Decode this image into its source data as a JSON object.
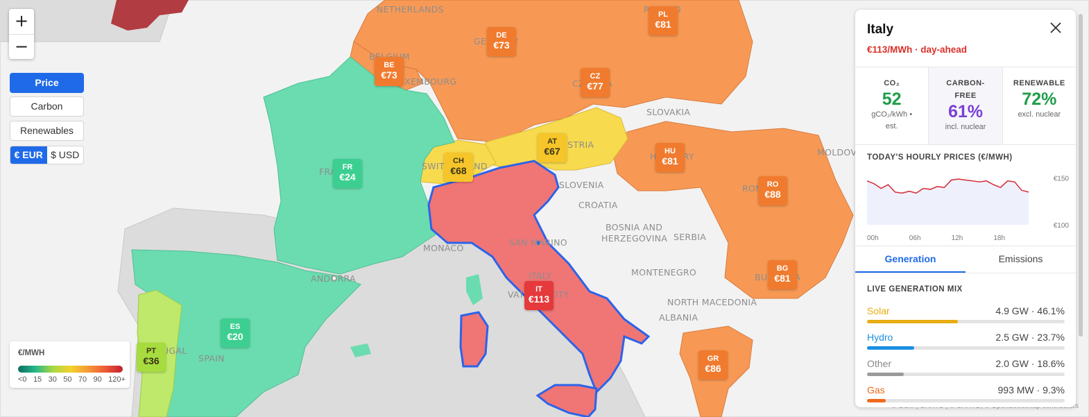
{
  "map": {
    "colors": {
      "water": "#dcdcdc",
      "land": "#f2f2f2",
      "border": "#b5b5b5"
    },
    "place_labels": [
      {
        "text": "NETHERLANDS"
      },
      {
        "text": "BELGIUM"
      },
      {
        "text": "GERMANY"
      },
      {
        "text": "POLAND"
      },
      {
        "text": "LUXEMBOURG"
      },
      {
        "text": "CZECHIA"
      },
      {
        "text": "SLOVAKIA"
      },
      {
        "text": "AUSTRIA"
      },
      {
        "text": "HUNGARY"
      },
      {
        "text": "MOLDOVA"
      },
      {
        "text": "FRANCE"
      },
      {
        "text": "SWITZERLAND"
      },
      {
        "text": "SLOVENIA"
      },
      {
        "text": "ROMANIA"
      },
      {
        "text": "CROATIA"
      },
      {
        "text": "BOSNIA AND"
      },
      {
        "text": "HERZEGOVINA"
      },
      {
        "text": "SERBIA"
      },
      {
        "text": "MONACO"
      },
      {
        "text": "SAN MARINO"
      },
      {
        "text": "MONTENEGRO"
      },
      {
        "text": "ITALY"
      },
      {
        "text": "ANDORRA"
      },
      {
        "text": "BULGARIA"
      },
      {
        "text": "VATICAN CITY"
      },
      {
        "text": "NORTH MACEDONIA"
      },
      {
        "text": "ALBANIA"
      },
      {
        "text": "PORTUGAL"
      },
      {
        "text": "SPAIN"
      }
    ],
    "markers": [
      {
        "code": "DE",
        "price": "€73",
        "color": "#f07b2e"
      },
      {
        "code": "PL",
        "price": "€81",
        "color": "#f07b2e"
      },
      {
        "code": "BE",
        "price": "€73",
        "color": "#f07b2e"
      },
      {
        "code": "CZ",
        "price": "€77",
        "color": "#f07b2e"
      },
      {
        "code": "FR",
        "price": "€24",
        "color": "#3ccf91"
      },
      {
        "code": "AT",
        "price": "€67",
        "color": "#f5c52a"
      },
      {
        "code": "CH",
        "price": "€68",
        "color": "#f5c52a"
      },
      {
        "code": "HU",
        "price": "€81",
        "color": "#f07b2e"
      },
      {
        "code": "RO",
        "price": "€88",
        "color": "#f07b2e"
      },
      {
        "code": "IT",
        "price": "€113",
        "color": "#e5393b"
      },
      {
        "code": "BG",
        "price": "€81",
        "color": "#f07b2e"
      },
      {
        "code": "ES",
        "price": "€20",
        "color": "#3ccf91"
      },
      {
        "code": "PT",
        "price": "€36",
        "color": "#a6dc3e"
      },
      {
        "code": "GR",
        "price": "€86",
        "color": "#f07b2e"
      }
    ]
  },
  "controls": {
    "zoom_in": "+",
    "zoom_out": "−",
    "modes": [
      {
        "label": "Price",
        "active": true
      },
      {
        "label": "Carbon",
        "active": false
      },
      {
        "label": "Renewables",
        "active": false
      }
    ],
    "currency": [
      {
        "label": "€ EUR",
        "active": true
      },
      {
        "label": "$ USD",
        "active": false
      }
    ]
  },
  "legend": {
    "title": "€/MWH",
    "ticks": [
      "<0",
      "15",
      "30",
      "50",
      "70",
      "90",
      "120+"
    ]
  },
  "attribution": "© OSM | CARTO | © CARTO, © OpenStreetMap contributors",
  "panel": {
    "title": "Italy",
    "close_icon": "close-icon",
    "subtitle": "€113/MWh · day-ahead",
    "stats": [
      {
        "label": "CO₂",
        "value": "52",
        "note": "gCO₂/kWh • est.",
        "color": "#1e9e4a"
      },
      {
        "label": "CARBON-FREE",
        "value": "61%",
        "note": "incl. nuclear",
        "color": "#7b3fd6"
      },
      {
        "label": "RENEWABLE",
        "value": "72%",
        "note": "excl. nuclear",
        "color": "#1e9e4a"
      }
    ],
    "hourly_title": "TODAY'S HOURLY PRICES (€/MWH)",
    "tabs": [
      {
        "label": "Generation",
        "active": true
      },
      {
        "label": "Emissions",
        "active": false
      }
    ],
    "mix_title": "LIVE GENERATION MIX",
    "mix": [
      {
        "name": "Solar",
        "value": "4.9 GW · 46.1%",
        "share": 46.1,
        "color": "#e8ad12"
      },
      {
        "name": "Hydro",
        "value": "2.5 GW · 23.7%",
        "share": 23.7,
        "color": "#1a8fe0"
      },
      {
        "name": "Other",
        "value": "2.0 GW · 18.6%",
        "share": 18.6,
        "color": "#999999"
      },
      {
        "name": "Gas",
        "value": "993 MW · 9.3%",
        "share": 9.3,
        "color": "#f06a1a"
      }
    ]
  },
  "chart_data": {
    "type": "line",
    "title": "TODAY'S HOURLY PRICES (€/MWH)",
    "x": [
      "00h",
      "01h",
      "02h",
      "03h",
      "04h",
      "05h",
      "06h",
      "07h",
      "08h",
      "09h",
      "10h",
      "11h",
      "12h",
      "13h",
      "14h",
      "15h",
      "16h",
      "17h",
      "18h",
      "19h",
      "20h",
      "21h",
      "22h",
      "23h"
    ],
    "xticks": [
      "00h",
      "06h",
      "12h",
      "18h"
    ],
    "yticks": [
      "€150",
      "€100"
    ],
    "ylim": [
      100,
      155
    ],
    "series": [
      {
        "values": [
          147,
          144,
          139,
          143,
          135,
          134,
          136,
          134,
          139,
          138,
          141,
          140,
          148,
          149,
          148,
          147,
          146,
          147,
          143,
          140,
          147,
          146,
          137,
          135
        ]
      }
    ],
    "line_color": "#d6353f",
    "fill_color": "#eef1fb"
  }
}
